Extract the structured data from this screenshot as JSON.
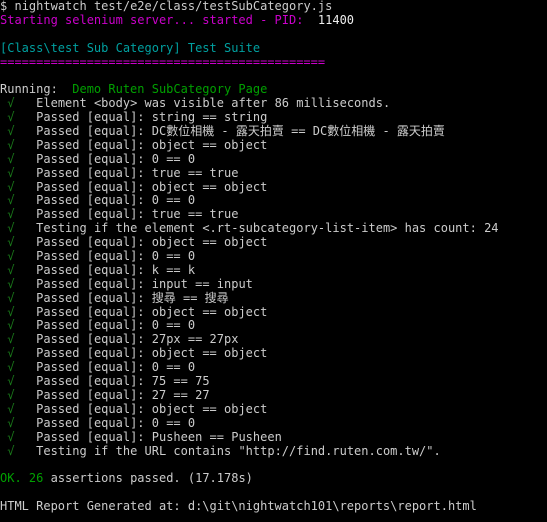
{
  "terminal": {
    "colors": {
      "background": "#000000",
      "text": "#cccccc",
      "magenta": "#cc00cc",
      "cyan": "#00a0a0",
      "green": "#00a000",
      "check": "#1a7a1a"
    },
    "prompt": {
      "symbol": "$",
      "command": "nightwatch test/e2e/class/testSubCategory.js"
    },
    "selenium": {
      "message": "Starting selenium server... started - PID:",
      "pid": "11400"
    },
    "suite": {
      "title": "[Class\\test Sub Category] Test Suite",
      "separator": "============================================="
    },
    "running": {
      "label": "Running:",
      "name": "Demo Ruten SubCategory Page"
    },
    "check_glyph": "√",
    "results": [
      {
        "text": "Element <body> was visible after 86 milliseconds."
      },
      {
        "text": "Passed [equal]: string == string"
      },
      {
        "text": "Passed [equal]: DC數位相機 - 露天拍賣 == DC數位相機 - 露天拍賣"
      },
      {
        "text": "Passed [equal]: object == object"
      },
      {
        "text": "Passed [equal]: 0 == 0"
      },
      {
        "text": "Passed [equal]: true == true"
      },
      {
        "text": "Passed [equal]: object == object"
      },
      {
        "text": "Passed [equal]: 0 == 0"
      },
      {
        "text": "Passed [equal]: true == true"
      },
      {
        "text": "Testing if the element <.rt-subcategory-list-item> has count: 24"
      },
      {
        "text": "Passed [equal]: object == object"
      },
      {
        "text": "Passed [equal]: 0 == 0"
      },
      {
        "text": "Passed [equal]: k == k"
      },
      {
        "text": "Passed [equal]: input == input"
      },
      {
        "text": "Passed [equal]: 搜尋 == 搜尋"
      },
      {
        "text": "Passed [equal]: object == object"
      },
      {
        "text": "Passed [equal]: 0 == 0"
      },
      {
        "text": "Passed [equal]: 27px == 27px"
      },
      {
        "text": "Passed [equal]: object == object"
      },
      {
        "text": "Passed [equal]: 0 == 0"
      },
      {
        "text": "Passed [equal]: 75 == 75"
      },
      {
        "text": "Passed [equal]: 27 == 27"
      },
      {
        "text": "Passed [equal]: object == object"
      },
      {
        "text": "Passed [equal]: 0 == 0"
      },
      {
        "text": "Passed [equal]: Pusheen == Pusheen"
      },
      {
        "text": "Testing if the URL contains \"http://find.ruten.com.tw/\"."
      }
    ],
    "summary": {
      "status": "OK.",
      "count": "26",
      "text": "assertions passed. (17.178s)"
    },
    "report": {
      "label": "HTML Report Generated at:",
      "path": "d:\\git\\nightwatch101\\reports\\report.html"
    }
  }
}
